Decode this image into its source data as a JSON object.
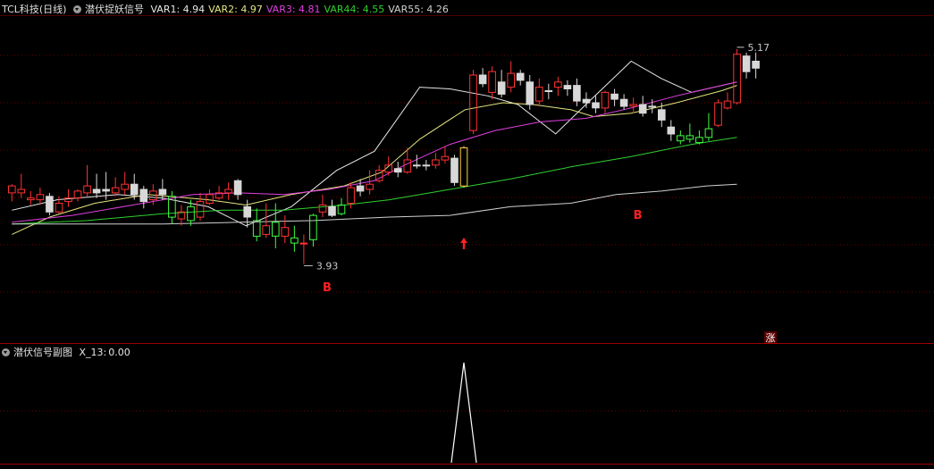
{
  "header": {
    "stock_name": "TCL科技(日线)",
    "indicator_name": "潜伏捉妖信号",
    "vars": [
      {
        "label": "VAR1:",
        "value": "4.94",
        "color": "#e8e8e8"
      },
      {
        "label": "VAR2:",
        "value": "4.97",
        "color": "#e6e680"
      },
      {
        "label": "VAR3:",
        "value": "4.81",
        "color": "#e040e0"
      },
      {
        "label": "VAR44:",
        "value": "4.55",
        "color": "#30d030"
      },
      {
        "label": "VAR55:",
        "value": "4.26",
        "color": "#d0d0d0"
      }
    ]
  },
  "sub_header": {
    "indicator_name": "潜伏信号副图",
    "label": "X_13:",
    "value": "0.00"
  },
  "colors": {
    "up": "#ff3232",
    "down": "#d8d8d8",
    "signal_green": "#40ff40",
    "signal_yellow": "#ffd040",
    "grid": "#6a0000",
    "border": "#a00000",
    "text": "#c8c8c8",
    "b_marker": "#ff2020"
  },
  "annotations": {
    "high_label": "5.17",
    "low_label": "3.93",
    "b_marker_1": "B",
    "b_marker_2": "B",
    "zhang_marker": "涨"
  },
  "chart_data": {
    "type": "candlestick",
    "ylim": [
      3.7,
      5.35
    ],
    "x_count": 78,
    "candles": [
      [
        4.34,
        4.38,
        4.29,
        4.39,
        "u"
      ],
      [
        4.34,
        4.36,
        4.31,
        4.45,
        "u"
      ],
      [
        4.3,
        4.31,
        4.27,
        4.35,
        "u"
      ],
      [
        4.3,
        4.33,
        4.27,
        4.37,
        "u"
      ],
      [
        4.32,
        4.23,
        4.21,
        4.34,
        "d"
      ],
      [
        4.23,
        4.28,
        4.22,
        4.32,
        "u"
      ],
      [
        4.29,
        4.31,
        4.26,
        4.36,
        "u"
      ],
      [
        4.31,
        4.35,
        4.29,
        4.36,
        "u"
      ],
      [
        4.34,
        4.38,
        4.32,
        4.5,
        "u"
      ],
      [
        4.36,
        4.34,
        4.31,
        4.45,
        "d"
      ],
      [
        4.36,
        4.35,
        4.3,
        4.46,
        "d"
      ],
      [
        4.34,
        4.37,
        4.32,
        4.43,
        "u"
      ],
      [
        4.36,
        4.39,
        4.33,
        4.46,
        "u"
      ],
      [
        4.39,
        4.33,
        4.3,
        4.45,
        "d"
      ],
      [
        4.36,
        4.29,
        4.25,
        4.38,
        "d"
      ],
      [
        4.3,
        4.35,
        4.27,
        4.39,
        "u"
      ],
      [
        4.36,
        4.33,
        4.3,
        4.42,
        "d"
      ],
      [
        4.32,
        4.2,
        4.16,
        4.35,
        "g"
      ],
      [
        4.19,
        4.23,
        4.15,
        4.27,
        "u"
      ],
      [
        4.26,
        4.18,
        4.15,
        4.3,
        "g"
      ],
      [
        4.2,
        4.29,
        4.18,
        4.34,
        "u"
      ],
      [
        4.28,
        4.33,
        4.27,
        4.36,
        "u"
      ],
      [
        4.31,
        4.34,
        4.3,
        4.38,
        "u"
      ],
      [
        4.34,
        4.36,
        4.3,
        4.4,
        "u"
      ],
      [
        4.41,
        4.33,
        4.3,
        4.42,
        "d"
      ],
      [
        4.26,
        4.2,
        4.14,
        4.3,
        "d"
      ],
      [
        4.18,
        4.09,
        4.06,
        4.25,
        "g"
      ],
      [
        4.1,
        4.15,
        4.08,
        4.28,
        "u"
      ],
      [
        4.17,
        4.09,
        4.02,
        4.28,
        "g"
      ],
      [
        4.09,
        4.14,
        4.05,
        4.21,
        "u"
      ],
      [
        4.08,
        4.05,
        4.0,
        4.15,
        "g"
      ],
      [
        4.05,
        4.05,
        3.93,
        4.1,
        "u"
      ],
      [
        4.07,
        4.21,
        4.03,
        4.22,
        "g"
      ],
      [
        4.23,
        4.27,
        4.2,
        4.33,
        "u"
      ],
      [
        4.26,
        4.21,
        4.2,
        4.3,
        "d"
      ],
      [
        4.22,
        4.27,
        4.21,
        4.31,
        "g"
      ],
      [
        4.28,
        4.37,
        4.25,
        4.4,
        "u"
      ],
      [
        4.38,
        4.35,
        4.32,
        4.42,
        "d"
      ],
      [
        4.36,
        4.39,
        4.33,
        4.47,
        "u"
      ],
      [
        4.41,
        4.47,
        4.4,
        4.5,
        "u"
      ],
      [
        4.46,
        4.5,
        4.44,
        4.55,
        "u"
      ],
      [
        4.48,
        4.46,
        4.43,
        4.52,
        "d"
      ],
      [
        4.46,
        4.53,
        4.45,
        4.6,
        "u"
      ],
      [
        4.5,
        4.5,
        4.48,
        4.56,
        "d"
      ],
      [
        4.5,
        4.5,
        4.47,
        4.53,
        "d"
      ],
      [
        4.5,
        4.53,
        4.48,
        4.57,
        "u"
      ],
      [
        4.53,
        4.55,
        4.51,
        4.61,
        "u"
      ],
      [
        4.54,
        4.4,
        4.38,
        4.56,
        "d"
      ],
      [
        4.38,
        4.6,
        4.37,
        4.61,
        "y"
      ],
      [
        4.7,
        5.02,
        4.68,
        5.05,
        "u"
      ],
      [
        5.02,
        4.97,
        4.95,
        5.06,
        "d"
      ],
      [
        4.92,
        5.04,
        4.88,
        5.07,
        "u"
      ],
      [
        4.98,
        4.91,
        4.89,
        5.05,
        "d"
      ],
      [
        4.95,
        5.03,
        4.92,
        5.1,
        "u"
      ],
      [
        5.03,
        4.99,
        4.96,
        5.05,
        "d"
      ],
      [
        4.98,
        4.85,
        4.82,
        5.02,
        "d"
      ],
      [
        4.87,
        4.95,
        4.84,
        5.0,
        "u"
      ],
      [
        4.93,
        4.93,
        4.88,
        4.97,
        "d"
      ],
      [
        4.95,
        4.98,
        4.9,
        5.01,
        "u"
      ],
      [
        4.96,
        4.94,
        4.9,
        4.99,
        "d"
      ],
      [
        4.96,
        4.87,
        4.84,
        5.0,
        "d"
      ],
      [
        4.88,
        4.86,
        4.83,
        4.92,
        "d"
      ],
      [
        4.86,
        4.83,
        4.8,
        4.9,
        "d"
      ],
      [
        4.83,
        4.92,
        4.8,
        4.93,
        "u"
      ],
      [
        4.91,
        4.88,
        4.84,
        4.94,
        "d"
      ],
      [
        4.88,
        4.84,
        4.82,
        4.91,
        "d"
      ],
      [
        4.84,
        4.85,
        4.8,
        4.89,
        "u"
      ],
      [
        4.85,
        4.8,
        4.78,
        4.9,
        "d"
      ],
      [
        4.84,
        4.84,
        4.8,
        4.88,
        "d"
      ],
      [
        4.82,
        4.76,
        4.72,
        4.86,
        "d"
      ],
      [
        4.72,
        4.68,
        4.64,
        4.76,
        "d"
      ],
      [
        4.67,
        4.64,
        4.62,
        4.7,
        "g"
      ],
      [
        4.65,
        4.67,
        4.63,
        4.74,
        "g"
      ],
      [
        4.66,
        4.63,
        4.62,
        4.7,
        "g"
      ],
      [
        4.66,
        4.71,
        4.64,
        4.8,
        "g"
      ],
      [
        4.73,
        4.86,
        4.72,
        4.88,
        "u"
      ],
      [
        4.83,
        4.87,
        4.82,
        4.92,
        "u"
      ],
      [
        4.86,
        5.14,
        4.85,
        5.17,
        "u"
      ],
      [
        5.04,
        5.13,
        5.0,
        5.15,
        "d"
      ],
      [
        5.1,
        5.06,
        5.0,
        5.15,
        "d"
      ]
    ],
    "series": [
      {
        "name": "VAR1",
        "color": "#e8e8e8",
        "points": [
          [
            0,
            4.24
          ],
          [
            6,
            4.3
          ],
          [
            14,
            4.33
          ],
          [
            20,
            4.31
          ],
          [
            26,
            4.26
          ],
          [
            31,
            4.15
          ],
          [
            37,
            4.26
          ],
          [
            43,
            4.47
          ],
          [
            48,
            4.58
          ],
          [
            54,
            4.95
          ],
          [
            58,
            4.94
          ],
          [
            63,
            4.9
          ],
          [
            67,
            4.85
          ],
          [
            72,
            4.68
          ],
          [
            76,
            4.85
          ],
          [
            82,
            5.1
          ],
          [
            86,
            5.0
          ],
          [
            90,
            4.92
          ],
          [
            96,
            4.98
          ]
        ]
      },
      {
        "name": "VAR2",
        "color": "#e6e680",
        "points": [
          [
            0,
            4.1
          ],
          [
            5,
            4.2
          ],
          [
            11,
            4.28
          ],
          [
            18,
            4.33
          ],
          [
            26,
            4.3
          ],
          [
            31,
            4.27
          ],
          [
            37,
            4.33
          ],
          [
            44,
            4.38
          ],
          [
            49,
            4.46
          ],
          [
            54,
            4.65
          ],
          [
            60,
            4.82
          ],
          [
            65,
            4.86
          ],
          [
            69,
            4.85
          ],
          [
            74,
            4.82
          ],
          [
            77,
            4.78
          ],
          [
            82,
            4.8
          ],
          [
            88,
            4.86
          ],
          [
            94,
            4.93
          ],
          [
            96,
            4.96
          ]
        ]
      },
      {
        "name": "VAR3",
        "color": "#e040e0",
        "points": [
          [
            0,
            4.17
          ],
          [
            8,
            4.21
          ],
          [
            16,
            4.27
          ],
          [
            24,
            4.33
          ],
          [
            30,
            4.34
          ],
          [
            36,
            4.33
          ],
          [
            42,
            4.36
          ],
          [
            48,
            4.41
          ],
          [
            52,
            4.5
          ],
          [
            58,
            4.62
          ],
          [
            64,
            4.7
          ],
          [
            70,
            4.75
          ],
          [
            76,
            4.77
          ],
          [
            82,
            4.83
          ],
          [
            88,
            4.9
          ],
          [
            94,
            4.96
          ],
          [
            96,
            4.98
          ]
        ]
      },
      {
        "name": "VAR44",
        "color": "#30d030",
        "points": [
          [
            0,
            4.16
          ],
          [
            10,
            4.18
          ],
          [
            20,
            4.22
          ],
          [
            28,
            4.24
          ],
          [
            36,
            4.24
          ],
          [
            44,
            4.27
          ],
          [
            50,
            4.3
          ],
          [
            58,
            4.36
          ],
          [
            66,
            4.42
          ],
          [
            74,
            4.49
          ],
          [
            82,
            4.55
          ],
          [
            90,
            4.62
          ],
          [
            96,
            4.66
          ]
        ]
      },
      {
        "name": "VAR55",
        "color": "#d0d0d0",
        "points": [
          [
            0,
            4.16
          ],
          [
            10,
            4.16
          ],
          [
            20,
            4.16
          ],
          [
            30,
            4.17
          ],
          [
            40,
            4.18
          ],
          [
            50,
            4.2
          ],
          [
            58,
            4.21
          ],
          [
            66,
            4.26
          ],
          [
            74,
            4.28
          ],
          [
            80,
            4.33
          ],
          [
            86,
            4.35
          ],
          [
            92,
            4.38
          ],
          [
            96,
            4.39
          ]
        ]
      }
    ],
    "signal_x": [
      48
    ],
    "sub_series": {
      "name": "X_13",
      "ylim": [
        0,
        1
      ],
      "spike_index": 48,
      "spike_value": 1
    }
  }
}
